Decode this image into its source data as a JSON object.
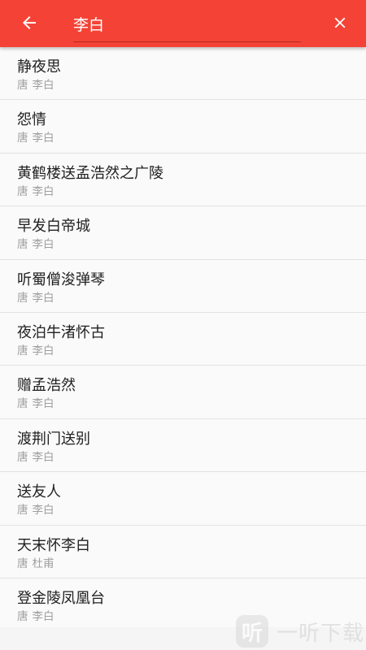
{
  "colors": {
    "app_bar": "#f44336",
    "title_text": "#212121",
    "meta_text": "#9e9e9e"
  },
  "icons": {
    "back": "arrow-left-icon",
    "clear": "close-icon"
  },
  "search": {
    "value": "李白"
  },
  "results": [
    {
      "title": "静夜思",
      "dynasty": "唐",
      "author": "李白"
    },
    {
      "title": "怨情",
      "dynasty": "唐",
      "author": "李白"
    },
    {
      "title": "黄鹤楼送孟浩然之广陵",
      "dynasty": "唐",
      "author": "李白"
    },
    {
      "title": "早发白帝城",
      "dynasty": "唐",
      "author": "李白"
    },
    {
      "title": "听蜀僧浚弹琴",
      "dynasty": "唐",
      "author": "李白"
    },
    {
      "title": "夜泊牛渚怀古",
      "dynasty": "唐",
      "author": "李白"
    },
    {
      "title": "赠孟浩然",
      "dynasty": "唐",
      "author": "李白"
    },
    {
      "title": "渡荆门送别",
      "dynasty": "唐",
      "author": "李白"
    },
    {
      "title": "送友人",
      "dynasty": "唐",
      "author": "李白"
    },
    {
      "title": "天末怀李白",
      "dynasty": "唐",
      "author": "杜甫"
    },
    {
      "title": "登金陵凤凰台",
      "dynasty": "唐",
      "author": "李白"
    }
  ],
  "watermark": {
    "logo": "听",
    "text": "一听下载"
  }
}
